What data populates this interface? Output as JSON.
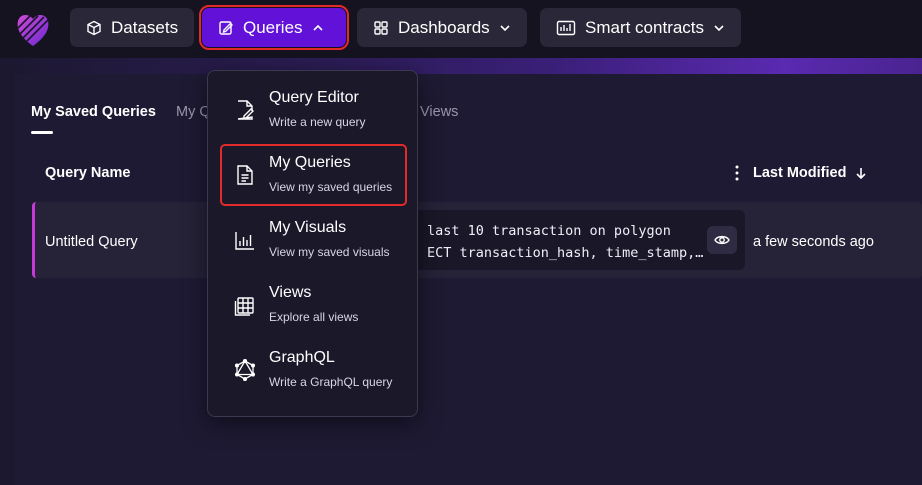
{
  "nav": {
    "datasets": "Datasets",
    "queries": "Queries",
    "dashboards": "Dashboards",
    "smart_contracts": "Smart contracts"
  },
  "tabs": {
    "saved": "My Saved Queries",
    "second_partial": "My Q",
    "views_partial": "Views"
  },
  "table": {
    "col_name": "Query Name",
    "col_modified": "Last Modified",
    "row": {
      "name": "Untitled Query",
      "code_line1": "last 10 transaction on polygon",
      "code_line2": "ECT transaction_hash, time_stamp,…",
      "modified": "a few seconds ago"
    }
  },
  "dropdown": {
    "items": [
      {
        "title": "Query Editor",
        "sub": "Write a new query",
        "icon": "edit-document-icon"
      },
      {
        "title": "My Queries",
        "sub": "View my saved queries",
        "icon": "document-icon"
      },
      {
        "title": "My Visuals",
        "sub": "View my saved visuals",
        "icon": "bar-chart-icon"
      },
      {
        "title": "Views",
        "sub": "Explore all views",
        "icon": "table-grid-icon"
      },
      {
        "title": "GraphQL",
        "sub": "Write a GraphQL query",
        "icon": "graphql-icon"
      }
    ]
  },
  "colors": {
    "accent": "#6211d8",
    "highlight_border": "#e32a2a",
    "row_accent": "#c43ad8"
  }
}
